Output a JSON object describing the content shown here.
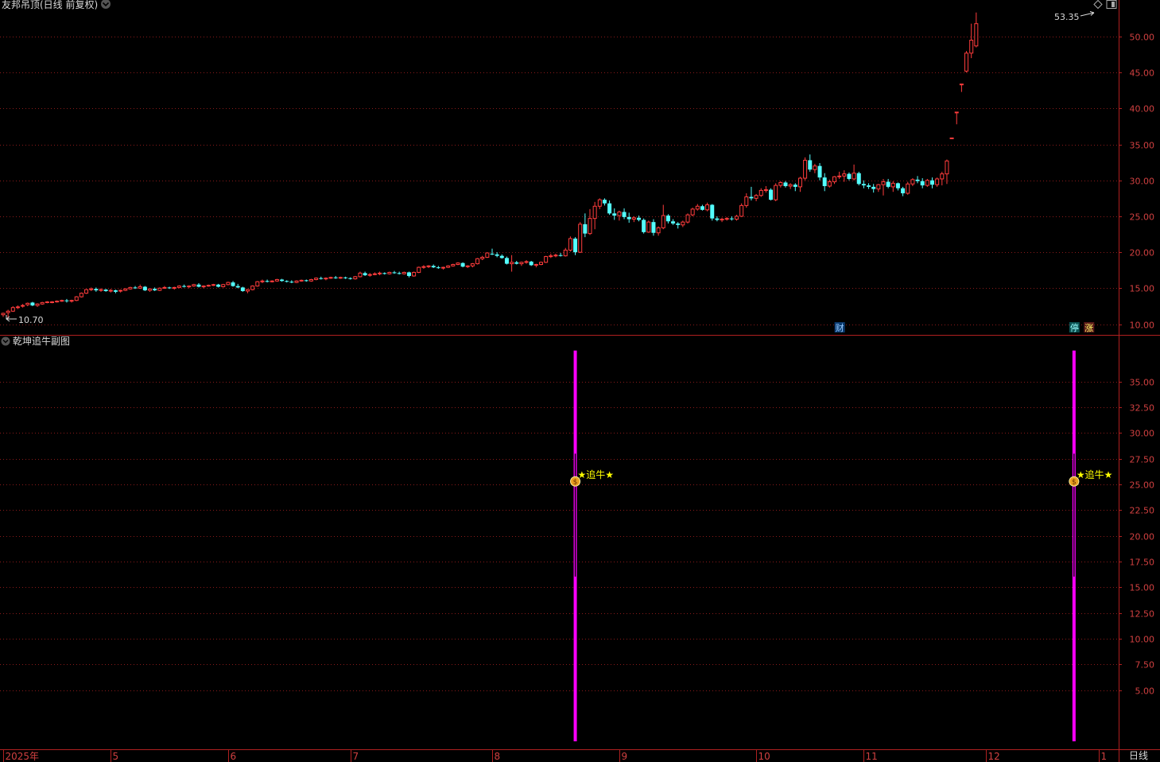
{
  "main_panel": {
    "title": "友邦吊顶(日线 前复权)",
    "low_label": "10.70",
    "high_label": "53.35",
    "markers": [
      {
        "text": "财",
        "bar": 171,
        "color": "#0a3a70",
        "text_color": "#9cf"
      },
      {
        "text": "停",
        "bar": 219,
        "color": "#0a5050",
        "text_color": "#9ff"
      },
      {
        "text": "涨",
        "bar": 222,
        "color": "#5a1a1a",
        "text_color": "#ff6"
      }
    ]
  },
  "sub_panel": {
    "title": "乾坤追牛副图",
    "signal_label": "★追牛★"
  },
  "x_axis": {
    "labels": [
      {
        "text": "2025年",
        "bar": 0
      },
      {
        "text": "5",
        "bar": 22
      },
      {
        "text": "6",
        "bar": 46
      },
      {
        "text": "7",
        "bar": 71
      },
      {
        "text": "8",
        "bar": 100
      },
      {
        "text": "9",
        "bar": 126
      },
      {
        "text": "10",
        "bar": 154
      },
      {
        "text": "11",
        "bar": 176
      },
      {
        "text": "12",
        "bar": 201
      },
      {
        "text": "1",
        "bar": 224
      }
    ],
    "period_label": "日线"
  },
  "colors": {
    "up": "#ff3c3c",
    "down": "#54ffff",
    "grid": "#8a1a1a",
    "axis_text": "#d04040",
    "signal": "#ff00ff",
    "signal_text": "#ffff00"
  },
  "chart_data": {
    "type": "candlestick",
    "title": "友邦吊顶(日线 前复权)",
    "y_ticks": [
      "10.00",
      "15.00",
      "20.00",
      "25.00",
      "30.00",
      "35.00",
      "40.00",
      "45.00",
      "50.00"
    ],
    "ylim": [
      9.6,
      55.0
    ],
    "ohlc_series": [
      [
        11.3,
        11.6,
        11.0,
        11.5
      ],
      [
        11.6,
        12.0,
        10.7,
        11.8
      ],
      [
        11.8,
        12.5,
        11.7,
        12.3
      ],
      [
        12.3,
        12.6,
        12.1,
        12.4
      ],
      [
        12.5,
        12.8,
        12.3,
        12.6
      ],
      [
        12.7,
        13.0,
        12.5,
        12.9
      ],
      [
        13.0,
        13.1,
        12.5,
        12.6
      ],
      [
        12.6,
        12.9,
        12.4,
        12.8
      ],
      [
        12.8,
        13.1,
        12.7,
        13.0
      ],
      [
        13.0,
        13.2,
        12.9,
        13.1
      ],
      [
        13.0,
        13.2,
        12.9,
        13.1
      ],
      [
        13.1,
        13.3,
        13.0,
        13.2
      ],
      [
        13.2,
        13.4,
        13.1,
        13.3
      ],
      [
        13.3,
        13.5,
        13.0,
        13.2
      ],
      [
        13.2,
        13.4,
        13.0,
        13.3
      ],
      [
        13.3,
        13.9,
        13.2,
        13.8
      ],
      [
        13.8,
        14.4,
        13.7,
        14.3
      ],
      [
        14.3,
        14.9,
        14.2,
        14.8
      ],
      [
        14.8,
        15.1,
        14.6,
        14.9
      ],
      [
        14.9,
        15.1,
        14.5,
        14.7
      ],
      [
        14.7,
        15.0,
        14.5,
        14.8
      ],
      [
        14.8,
        14.9,
        14.5,
        14.6
      ],
      [
        14.6,
        14.9,
        14.4,
        14.7
      ],
      [
        14.7,
        14.8,
        14.3,
        14.5
      ],
      [
        14.6,
        14.8,
        14.4,
        14.7
      ],
      [
        14.7,
        15.0,
        14.6,
        14.9
      ],
      [
        14.9,
        15.2,
        14.8,
        15.1
      ],
      [
        15.1,
        15.3,
        14.9,
        15.0
      ],
      [
        15.0,
        15.5,
        14.9,
        15.2
      ],
      [
        15.2,
        15.3,
        14.6,
        14.7
      ],
      [
        14.7,
        15.0,
        14.5,
        14.9
      ],
      [
        14.9,
        15.1,
        14.6,
        14.7
      ],
      [
        14.7,
        15.1,
        14.6,
        15.0
      ],
      [
        15.0,
        15.3,
        14.9,
        15.1
      ],
      [
        15.1,
        15.2,
        14.9,
        15.0
      ],
      [
        15.0,
        15.2,
        14.8,
        15.1
      ],
      [
        15.1,
        15.4,
        15.0,
        15.3
      ],
      [
        15.3,
        15.5,
        15.1,
        15.2
      ],
      [
        15.2,
        15.4,
        15.0,
        15.3
      ],
      [
        15.3,
        15.6,
        15.2,
        15.5
      ],
      [
        15.5,
        15.7,
        15.1,
        15.2
      ],
      [
        15.2,
        15.4,
        15.0,
        15.3
      ],
      [
        15.3,
        15.5,
        15.2,
        15.4
      ],
      [
        15.4,
        15.6,
        15.3,
        15.5
      ],
      [
        15.5,
        15.6,
        15.1,
        15.2
      ],
      [
        15.2,
        15.6,
        15.1,
        15.5
      ],
      [
        15.5,
        15.9,
        15.4,
        15.8
      ],
      [
        15.8,
        16.0,
        15.2,
        15.3
      ],
      [
        15.3,
        15.6,
        15.0,
        15.1
      ],
      [
        15.1,
        15.2,
        14.5,
        14.6
      ],
      [
        14.6,
        14.9,
        14.3,
        14.8
      ],
      [
        14.8,
        15.4,
        14.7,
        15.3
      ],
      [
        15.3,
        16.0,
        15.2,
        15.9
      ],
      [
        15.9,
        16.2,
        15.7,
        16.0
      ],
      [
        16.0,
        16.2,
        15.8,
        15.9
      ],
      [
        15.9,
        16.1,
        15.8,
        16.0
      ],
      [
        16.0,
        16.3,
        15.9,
        16.2
      ],
      [
        16.2,
        16.3,
        15.9,
        16.0
      ],
      [
        16.0,
        16.1,
        15.8,
        15.9
      ],
      [
        15.9,
        16.1,
        15.7,
        15.8
      ],
      [
        15.8,
        16.1,
        15.7,
        16.0
      ],
      [
        16.0,
        16.2,
        15.9,
        16.1
      ],
      [
        16.1,
        16.2,
        15.9,
        16.0
      ],
      [
        16.0,
        16.3,
        15.9,
        16.2
      ],
      [
        16.2,
        16.5,
        16.1,
        16.4
      ],
      [
        16.4,
        16.6,
        16.2,
        16.3
      ],
      [
        16.3,
        16.5,
        16.1,
        16.4
      ],
      [
        16.4,
        16.6,
        16.3,
        16.5
      ],
      [
        16.5,
        16.7,
        16.3,
        16.4
      ],
      [
        16.4,
        16.6,
        16.3,
        16.5
      ],
      [
        16.5,
        16.6,
        16.3,
        16.4
      ],
      [
        16.4,
        16.5,
        16.2,
        16.3
      ],
      [
        16.3,
        16.7,
        16.2,
        16.6
      ],
      [
        16.6,
        17.3,
        16.5,
        17.1
      ],
      [
        17.1,
        17.3,
        16.7,
        16.8
      ],
      [
        16.8,
        17.1,
        16.6,
        16.9
      ],
      [
        16.9,
        17.2,
        16.8,
        17.0
      ],
      [
        17.0,
        17.3,
        16.8,
        17.1
      ],
      [
        17.1,
        17.2,
        16.9,
        17.0
      ],
      [
        17.0,
        17.3,
        16.9,
        17.2
      ],
      [
        17.2,
        17.4,
        17.0,
        17.1
      ],
      [
        17.1,
        17.3,
        16.9,
        17.0
      ],
      [
        17.0,
        17.3,
        16.9,
        17.2
      ],
      [
        17.2,
        17.3,
        16.5,
        16.7
      ],
      [
        16.7,
        17.3,
        16.6,
        17.2
      ],
      [
        17.2,
        18.0,
        17.1,
        17.9
      ],
      [
        17.9,
        18.2,
        17.7,
        18.0
      ],
      [
        18.0,
        18.2,
        17.8,
        18.1
      ],
      [
        18.1,
        18.3,
        17.8,
        17.9
      ],
      [
        17.9,
        18.1,
        17.7,
        17.8
      ],
      [
        17.8,
        18.0,
        17.6,
        17.9
      ],
      [
        17.9,
        18.2,
        17.8,
        18.1
      ],
      [
        18.1,
        18.4,
        18.0,
        18.3
      ],
      [
        18.3,
        18.6,
        18.2,
        18.5
      ],
      [
        18.5,
        18.6,
        17.9,
        18.0
      ],
      [
        18.0,
        18.2,
        17.8,
        18.1
      ],
      [
        18.1,
        18.5,
        17.9,
        18.4
      ],
      [
        18.4,
        19.2,
        18.3,
        19.1
      ],
      [
        19.1,
        19.5,
        18.9,
        19.3
      ],
      [
        19.3,
        20.0,
        19.2,
        19.9
      ],
      [
        19.8,
        20.5,
        19.6,
        19.7
      ],
      [
        19.7,
        20.0,
        19.3,
        19.5
      ],
      [
        19.5,
        19.7,
        19.1,
        19.2
      ],
      [
        19.2,
        19.4,
        18.3,
        18.4
      ],
      [
        18.4,
        19.6,
        17.3,
        18.6
      ],
      [
        18.6,
        18.8,
        18.3,
        18.4
      ],
      [
        18.4,
        18.7,
        18.1,
        18.6
      ],
      [
        18.6,
        18.9,
        18.4,
        18.7
      ],
      [
        18.7,
        18.8,
        18.1,
        18.2
      ],
      [
        18.2,
        18.4,
        17.9,
        18.3
      ],
      [
        18.3,
        18.7,
        18.2,
        18.6
      ],
      [
        18.6,
        19.5,
        18.5,
        19.4
      ],
      [
        19.4,
        19.8,
        19.2,
        19.5
      ],
      [
        19.5,
        19.8,
        19.3,
        19.6
      ],
      [
        19.6,
        19.9,
        19.4,
        19.5
      ],
      [
        19.5,
        20.6,
        19.4,
        20.3
      ],
      [
        20.3,
        22.2,
        20.1,
        21.9
      ],
      [
        21.9,
        22.1,
        19.6,
        20.0
      ],
      [
        20.0,
        24.2,
        19.9,
        23.9
      ],
      [
        23.9,
        25.4,
        22.1,
        22.6
      ],
      [
        22.6,
        26.0,
        22.4,
        24.7
      ],
      [
        24.7,
        27.0,
        23.2,
        26.4
      ],
      [
        26.4,
        27.5,
        26.0,
        27.3
      ],
      [
        27.3,
        27.5,
        26.5,
        26.8
      ],
      [
        26.8,
        27.2,
        25.2,
        25.4
      ],
      [
        25.4,
        26.1,
        24.5,
        25.1
      ],
      [
        25.1,
        25.8,
        24.4,
        25.6
      ],
      [
        25.6,
        26.1,
        24.6,
        24.9
      ],
      [
        24.9,
        25.5,
        24.1,
        24.6
      ],
      [
        24.6,
        25.0,
        24.2,
        24.8
      ],
      [
        24.8,
        25.1,
        24.3,
        24.5
      ],
      [
        24.5,
        24.7,
        22.6,
        22.8
      ],
      [
        22.8,
        24.4,
        22.7,
        24.2
      ],
      [
        24.2,
        24.6,
        22.3,
        22.7
      ],
      [
        22.7,
        23.6,
        22.3,
        23.4
      ],
      [
        23.4,
        26.6,
        23.2,
        25.1
      ],
      [
        25.1,
        25.3,
        24.0,
        24.3
      ],
      [
        24.3,
        24.6,
        23.8,
        24.0
      ],
      [
        24.0,
        24.2,
        23.3,
        23.8
      ],
      [
        23.8,
        24.4,
        23.5,
        24.2
      ],
      [
        24.2,
        25.4,
        24.0,
        25.2
      ],
      [
        25.2,
        26.2,
        25.0,
        26.0
      ],
      [
        26.0,
        26.7,
        25.8,
        26.4
      ],
      [
        26.4,
        26.6,
        25.8,
        25.9
      ],
      [
        25.9,
        26.9,
        25.7,
        26.6
      ],
      [
        26.6,
        26.7,
        24.4,
        24.7
      ],
      [
        24.7,
        25.0,
        24.3,
        24.5
      ],
      [
        24.5,
        24.8,
        24.2,
        24.6
      ],
      [
        24.6,
        24.9,
        24.4,
        24.7
      ],
      [
        24.7,
        25.0,
        24.4,
        24.6
      ],
      [
        24.6,
        25.2,
        24.4,
        25.0
      ],
      [
        25.0,
        26.8,
        24.9,
        26.5
      ],
      [
        26.5,
        28.2,
        26.2,
        27.7
      ],
      [
        27.7,
        29.1,
        27.2,
        27.5
      ],
      [
        27.5,
        28.1,
        27.1,
        27.9
      ],
      [
        27.9,
        28.9,
        27.7,
        28.6
      ],
      [
        28.6,
        29.2,
        28.3,
        28.7
      ],
      [
        28.7,
        28.9,
        27.2,
        27.3
      ],
      [
        27.3,
        29.6,
        27.1,
        29.3
      ],
      [
        29.3,
        29.9,
        29.0,
        29.7
      ],
      [
        29.7,
        29.9,
        29.0,
        29.2
      ],
      [
        29.2,
        29.6,
        28.8,
        29.4
      ],
      [
        29.4,
        29.6,
        28.5,
        29.1
      ],
      [
        29.1,
        30.5,
        28.4,
        30.3
      ],
      [
        30.3,
        33.2,
        30.0,
        32.8
      ],
      [
        32.8,
        33.6,
        31.2,
        31.5
      ],
      [
        31.5,
        32.3,
        31.0,
        32.0
      ],
      [
        32.0,
        32.4,
        30.0,
        30.4
      ],
      [
        30.4,
        31.0,
        28.5,
        29.2
      ],
      [
        29.2,
        30.1,
        29.0,
        29.8
      ],
      [
        29.8,
        30.6,
        29.5,
        30.5
      ],
      [
        30.5,
        31.2,
        30.2,
        30.6
      ],
      [
        30.6,
        31.4,
        29.8,
        30.9
      ],
      [
        30.9,
        31.1,
        30.0,
        30.2
      ],
      [
        30.2,
        32.2,
        30.0,
        31.0
      ],
      [
        31.0,
        31.2,
        29.3,
        29.5
      ],
      [
        29.5,
        30.0,
        28.9,
        29.3
      ],
      [
        29.3,
        29.6,
        28.8,
        29.1
      ],
      [
        29.1,
        29.5,
        28.3,
        28.8
      ],
      [
        28.8,
        29.5,
        28.4,
        29.4
      ],
      [
        29.4,
        30.2,
        27.9,
        29.8
      ],
      [
        29.8,
        30.2,
        28.9,
        29.1
      ],
      [
        29.1,
        29.9,
        28.4,
        29.6
      ],
      [
        29.6,
        29.7,
        28.6,
        28.9
      ],
      [
        28.9,
        29.1,
        27.8,
        28.2
      ],
      [
        28.2,
        29.8,
        28.0,
        29.5
      ],
      [
        29.5,
        30.3,
        29.2,
        30.1
      ],
      [
        30.1,
        30.6,
        29.6,
        29.9
      ],
      [
        29.9,
        30.3,
        28.9,
        29.3
      ],
      [
        29.3,
        30.2,
        29.1,
        30.0
      ],
      [
        30.0,
        30.4,
        28.9,
        29.4
      ],
      [
        29.4,
        30.4,
        29.1,
        30.2
      ],
      [
        30.2,
        31.2,
        29.3,
        30.9
      ],
      [
        30.9,
        32.9,
        29.5,
        32.7
      ],
      [
        35.9,
        35.9,
        35.9,
        35.9
      ],
      [
        39.5,
        39.5,
        37.8,
        39.5
      ],
      [
        43.4,
        43.4,
        42.3,
        43.4
      ],
      [
        45.2,
        48.0,
        45.0,
        47.7
      ],
      [
        47.7,
        51.8,
        47.0,
        49.5
      ],
      [
        48.7,
        53.35,
        48.5,
        51.8
      ]
    ],
    "sub_panel": {
      "title": "乾坤追牛副图",
      "y_ticks": [
        "5.00",
        "7.50",
        "10.00",
        "12.50",
        "15.00",
        "17.50",
        "20.00",
        "22.50",
        "25.00",
        "27.50",
        "30.00",
        "32.50",
        "35.00"
      ],
      "ylim": [
        0,
        39.5
      ],
      "signals": [
        {
          "bar": 117,
          "low": 0,
          "high": 38.0,
          "label": "★追牛★",
          "label_y": 25.9
        },
        {
          "bar": 219,
          "low": 0,
          "high": 38.0,
          "label": "★追牛★",
          "label_y": 25.9
        }
      ]
    }
  }
}
